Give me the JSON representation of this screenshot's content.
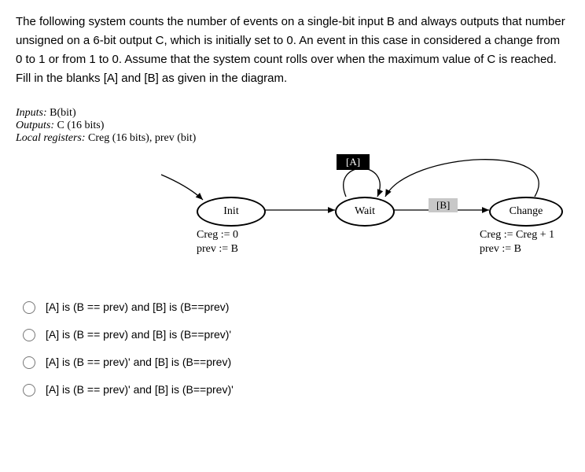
{
  "question": "The following system counts the number of events on a single-bit input B and always outputs that number unsigned on a 6-bit output C, which is initially set to 0. An event in this case in considered a change from 0 to 1 or from 1 to 0. Assume that the system count rolls over when the maximum value of C is reached. Fill in the blanks [A] and [B] as given in the diagram.",
  "decl": {
    "inputs_label": "Inputs:",
    "inputs_value": " B(bit)",
    "outputs_label": "Outputs:",
    "outputs_value": " C (16 bits)",
    "local_label": "Local registers:",
    "local_value": " Creg (16 bits), prev (bit)"
  },
  "diagram": {
    "labelA": "[A]",
    "labelB": "[B]",
    "init": "Init",
    "wait": "Wait",
    "change": "Change",
    "init_actions_1": "Creg := 0",
    "init_actions_2": "prev := B",
    "change_actions_1": "Creg := Creg + 1",
    "change_actions_2": "prev := B"
  },
  "options": {
    "o1": "[A] is (B == prev) and [B] is (B==prev)",
    "o2": "[A] is (B == prev) and [B] is (B==prev)'",
    "o3": "[A] is (B == prev)' and [B] is (B==prev)",
    "o4": "[A] is (B == prev)' and [B] is (B==prev)'"
  }
}
